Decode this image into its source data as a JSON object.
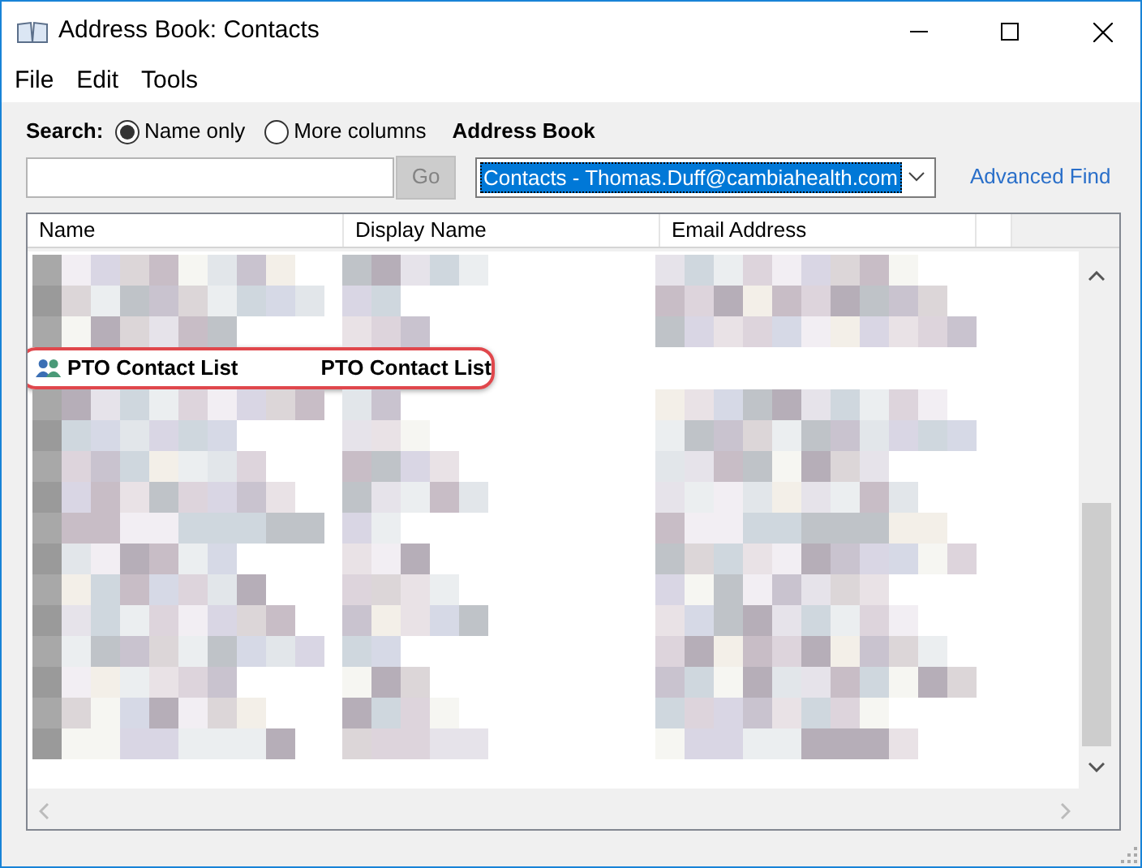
{
  "window": {
    "title": "Address Book: Contacts"
  },
  "menu": [
    "File",
    "Edit",
    "Tools"
  ],
  "search": {
    "label": "Search:",
    "options": [
      {
        "label": "Name only",
        "selected": true
      },
      {
        "label": "More columns",
        "selected": false
      }
    ],
    "go_button": {
      "label": "Go",
      "disabled": true
    }
  },
  "address_book": {
    "label": "Address Book",
    "value": "Contacts - Thomas.Duff@cambiahealth.com",
    "advanced_find": "Advanced Find"
  },
  "table": {
    "columns": [
      "Name",
      "Display Name",
      "Email Address"
    ],
    "rows": [
      {
        "name": "PTO Contact List",
        "display_name": "PTO Contact List",
        "highlighted": true
      }
    ]
  }
}
